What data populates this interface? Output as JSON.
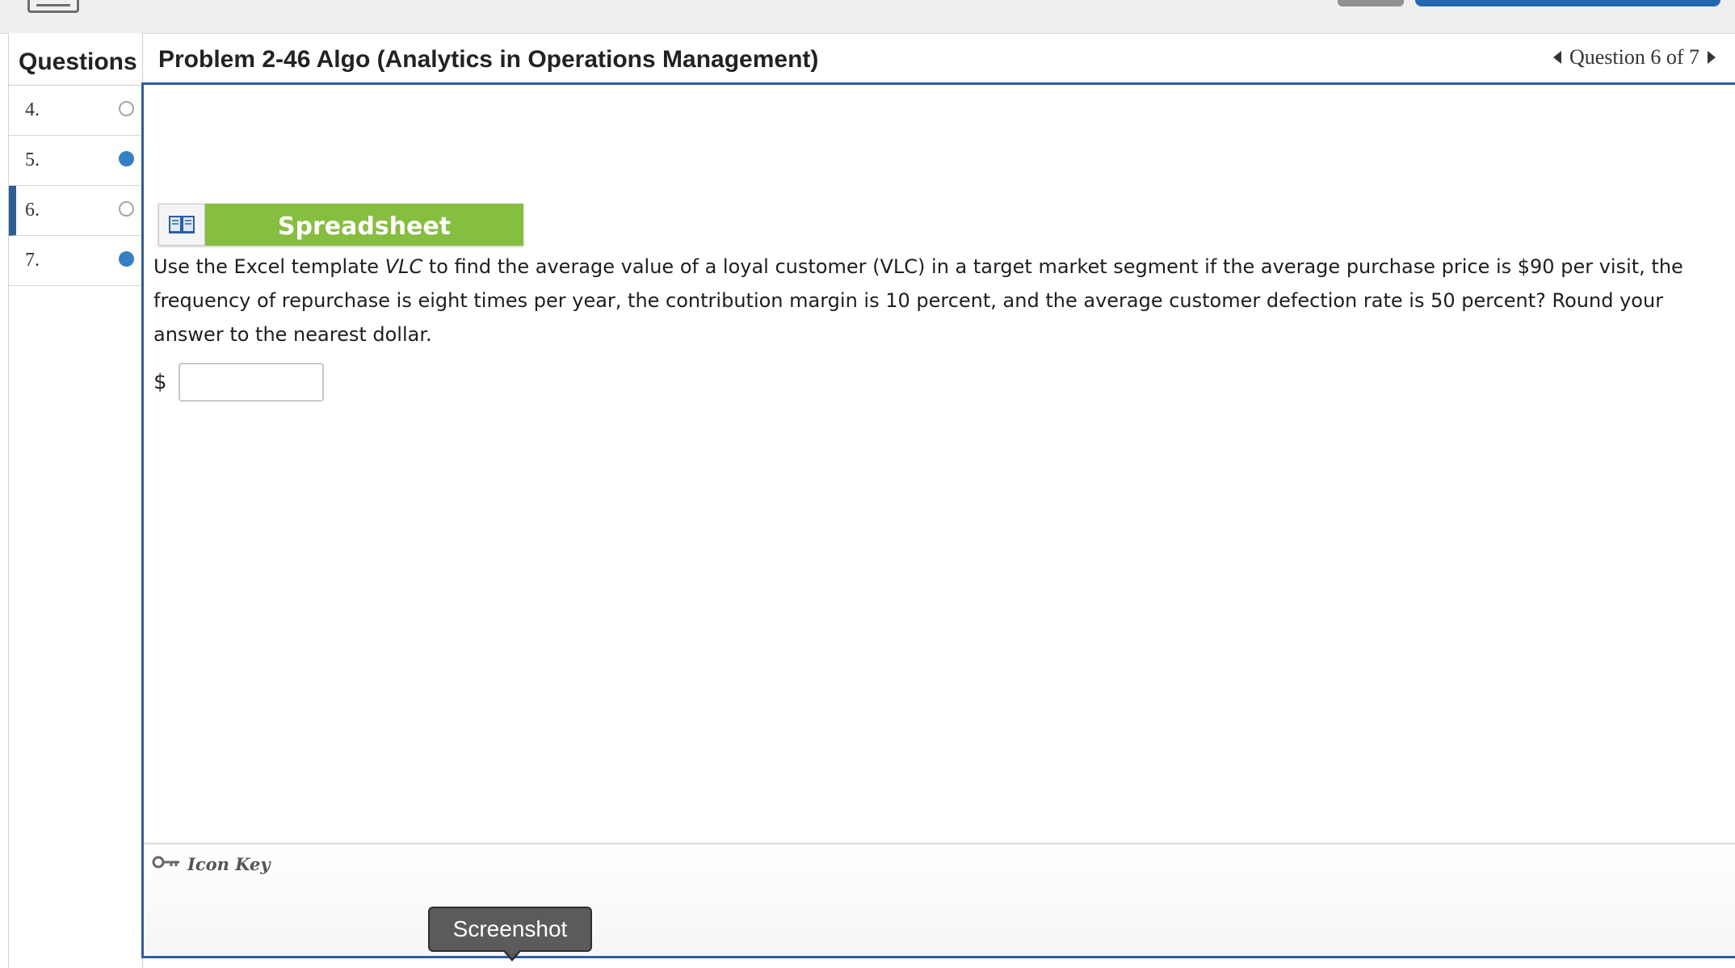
{
  "sidebar": {
    "header": "Questions",
    "items": [
      {
        "label": "4.",
        "status": "unanswered"
      },
      {
        "label": "5.",
        "status": "answered"
      },
      {
        "label": "6.",
        "status": "unanswered",
        "current": true
      },
      {
        "label": "7.",
        "status": "answered"
      }
    ]
  },
  "header": {
    "title": "Problem 2-46 Algo (Analytics in Operations Management)",
    "nav_label": "Question 6 of 7"
  },
  "main": {
    "spreadsheet_label": "Spreadsheet",
    "question_part1": "Use the Excel template ",
    "question_template_name": "VLC",
    "question_part2": " to find the average value of a loyal customer (VLC) in a target market segment if the average purchase price is $90 per visit, the frequency of repurchase is eight times per year, the contribution margin is 10 percent, and the average customer defection rate is 50 percent? Round your answer to the nearest dollar.",
    "currency_symbol": "$",
    "answer_value": "",
    "icon_key_label": "Icon Key"
  },
  "tooltip": {
    "text": "Screenshot"
  },
  "colors": {
    "accent_blue": "#2c5ea8",
    "answered_dot": "#3580c5",
    "spreadsheet_green": "#86be3f"
  },
  "icons": [
    "keyboard-icon",
    "book-icon",
    "key-icon",
    "prev-arrow-icon",
    "next-arrow-icon"
  ]
}
